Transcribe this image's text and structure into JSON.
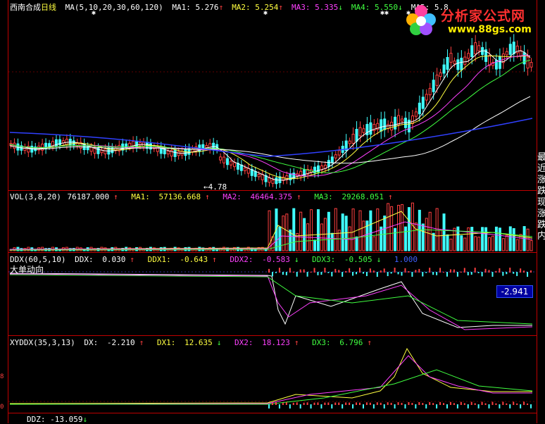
{
  "header": {
    "stock_name": "西南合成",
    "period": "日线",
    "ma_params": "MA(5,10,20,30,60,120)",
    "ma": [
      {
        "label": "MA1:",
        "value": "5.276",
        "arrow": "↑",
        "color": "#ffffff"
      },
      {
        "label": "MA2:",
        "value": "5.254",
        "arrow": "↑",
        "color": "#ffff40"
      },
      {
        "label": "MA3:",
        "value": "5.335",
        "arrow": "↓",
        "color": "#ff40ff"
      },
      {
        "label": "MA4:",
        "value": "5.550",
        "arrow": "↓",
        "color": "#40ff40"
      },
      {
        "label": "MA5:",
        "value": "5.8",
        "arrow": "",
        "color": "#ffffff"
      }
    ]
  },
  "price_panel": {
    "low_label": "4.78"
  },
  "vol_panel": {
    "params": "VOL(3,8,20)",
    "vol": {
      "value": "76187.000",
      "arrow": "↑"
    },
    "ma1": {
      "label": "MA1:",
      "value": "57136.668",
      "arrow": "↑"
    },
    "ma2": {
      "label": "MA2:",
      "value": "46464.375",
      "arrow": "↑"
    },
    "ma3": {
      "label": "MA3:",
      "value": "29268.051",
      "arrow": "↑"
    }
  },
  "ddx_panel": {
    "params": "DDX(60,5,10)",
    "ddx": {
      "label": "DDX:",
      "value": "0.030",
      "arrow": "↑"
    },
    "ddx1": {
      "label": "DDX1:",
      "value": "-0.643",
      "arrow": "↑"
    },
    "ddx2": {
      "label": "DDX2:",
      "value": "-0.583",
      "arrow": "↓"
    },
    "ddx3": {
      "label": "DDX3:",
      "value": "-0.505",
      "arrow": "↓"
    },
    "extra": "1.000",
    "subtitle": "大单动向",
    "box_value": "-2.941"
  },
  "xyddx_panel": {
    "params": "XYDDX(35,3,13)",
    "dx": {
      "label": "DX:",
      "value": "-2.210",
      "arrow": "↑"
    },
    "dx1": {
      "label": "DX1:",
      "value": "12.635",
      "arrow": "↓"
    },
    "dx2": {
      "label": "DX2:",
      "value": "18.123",
      "arrow": "↑"
    },
    "dx3": {
      "label": "DX3:",
      "value": "6.796",
      "arrow": "↑"
    }
  },
  "ddz_panel": {
    "ddz": {
      "label": "DDZ:",
      "value": "-13.059",
      "arrow": "↓"
    }
  },
  "side_labels": {
    "vertical_text": "最近涨跌现涨跌内",
    "y_tick_1": "8",
    "y_tick_2": "0"
  },
  "logo": {
    "title": "分析家公式网",
    "url": "www.88gs.com"
  },
  "colors": {
    "background": "#000000",
    "up": "#ff4040",
    "down": "#40ffff",
    "panel_border": "#c00000"
  }
}
